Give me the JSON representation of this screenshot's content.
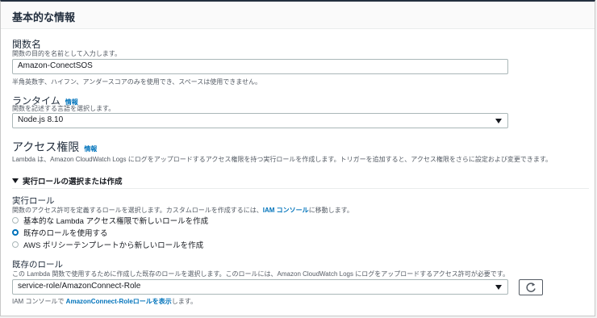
{
  "section": {
    "title": "基本的な情報"
  },
  "function_name": {
    "label": "関数名",
    "description": "関数の目的を名前として入力します。",
    "value": "Amazon-ConectSOS",
    "hint": "半角英数字、ハイフン、アンダースコアのみを使用でき、スペースは使用できません。"
  },
  "runtime": {
    "label": "ランタイム",
    "info": "情報",
    "description": "関数を記述する言語を選択します。",
    "value": "Node.js 8.10"
  },
  "permissions": {
    "heading": "アクセス権限",
    "info": "情報",
    "description": "Lambda は、Amazon CloudWatch Logs にログをアップロードするアクセス権限を持つ実行ロールを作成します。トリガーを追加すると、アクセス権限をさらに設定および変更できます。",
    "expand_label": "実行ロールの選択または作成"
  },
  "execution_role": {
    "label": "実行ロール",
    "description_prefix": "関数のアクセス許可を定義するロールを選択します。カスタムロールを作成するには、",
    "description_link": "IAM コンソール",
    "description_suffix": "に移動します。",
    "options": [
      {
        "label": "基本的な Lambda アクセス権限で新しいロールを作成",
        "selected": false
      },
      {
        "label": "既存のロールを使用する",
        "selected": true
      },
      {
        "label": "AWS ポリシーテンプレートから新しいロールを作成",
        "selected": false
      }
    ]
  },
  "existing_role": {
    "label": "既存のロール",
    "description": "この Lambda 関数で使用するために作成した既存のロールを選択します。このロールには、Amazon CloudWatch Logs にログをアップロードするアクセス許可が必要です。",
    "value": "service-role/AmazonConnect-Role",
    "footer_prefix": "IAM コンソールで ",
    "footer_link": "AmazonConnect-Roleロールを表示",
    "footer_suffix": "します。"
  },
  "icons": {
    "refresh": "refresh-icon",
    "dropdown": "chevron-down-icon",
    "expand": "caret-down-icon"
  },
  "colors": {
    "accent": "#0073bb",
    "header_border": "#232f3e"
  }
}
